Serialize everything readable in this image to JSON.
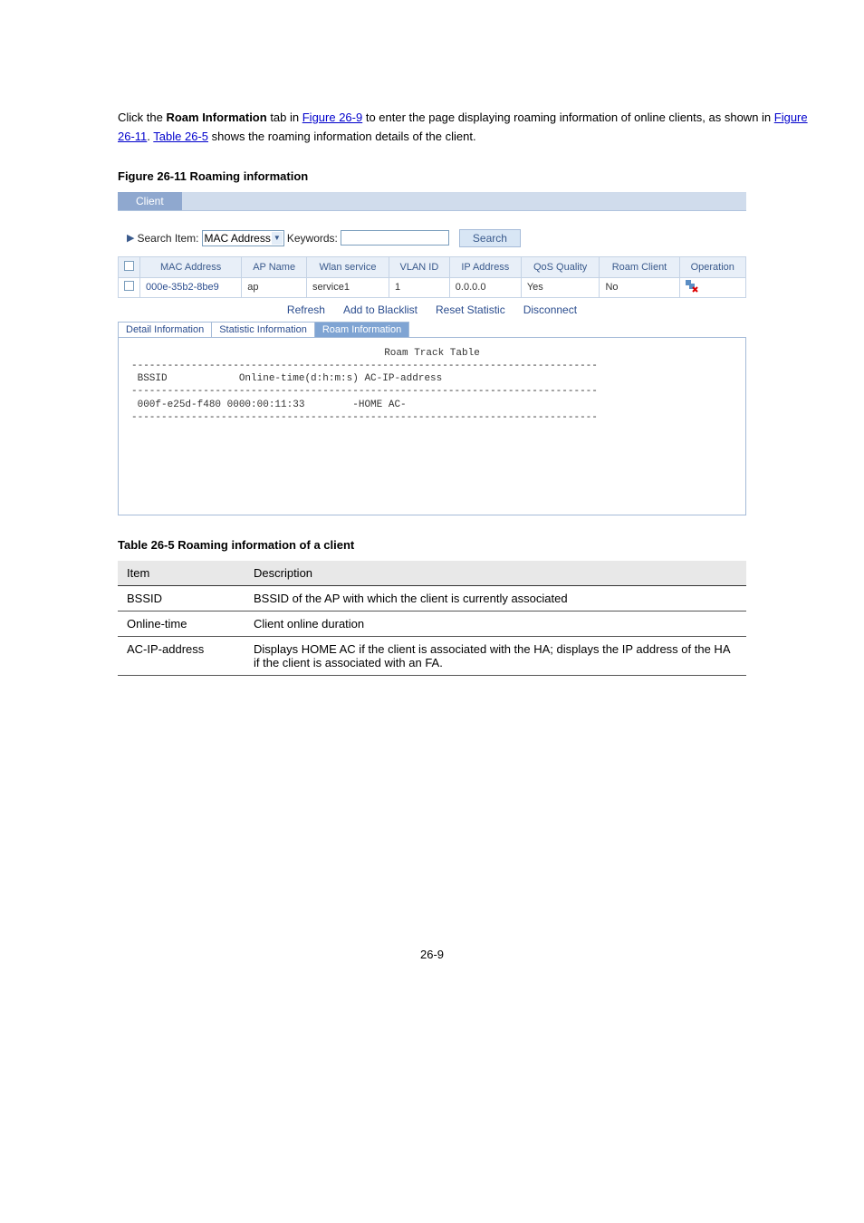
{
  "instruction": {
    "prefix": "Click the ",
    "tab_name": "Roam Information",
    "middle": " tab in ",
    "figure_ref": "Figure 26-9",
    "suffix": " to enter the page displaying roaming information of online clients, as shown in ",
    "figure_ref2": "Figure 26-11",
    "period": ". ",
    "table_ref": "Table 26-5",
    "table_suffix": " shows the roaming information details of the client."
  },
  "figure_caption": "Figure 26-11 Roaming information",
  "screenshot": {
    "tab": "Client",
    "search": {
      "label_item": "Search Item:",
      "select_value": "MAC Address",
      "label_keywords": "Keywords:",
      "input_value": "",
      "button": "Search"
    },
    "table_headers": [
      "MAC Address",
      "AP Name",
      "Wlan service",
      "VLAN ID",
      "IP Address",
      "QoS Quality",
      "Roam Client",
      "Operation"
    ],
    "table_row": {
      "mac": "000e-35b2-8be9",
      "ap": "ap",
      "wlan": "service1",
      "vlan": "1",
      "ip": "0.0.0.0",
      "qos": "Yes",
      "roam": "No",
      "op_icon": "disconnect-icon"
    },
    "actions": [
      "Refresh",
      "Add to Blacklist",
      "Reset Statistic",
      "Disconnect"
    ],
    "inner_tabs": [
      "Detail Information",
      "Statistic Information",
      "Roam Information"
    ],
    "roam_panel": {
      "title": "Roam Track Table",
      "sep": "------------------------------------------------------------------------------",
      "header": "BSSID            Online-time(d:h:m:s) AC-IP-address",
      "row": "000f-e25d-f480 0000:00:11:33        -HOME AC-"
    }
  },
  "table_caption": "Table 26-5 Roaming information of a client",
  "desc_table": {
    "headers": [
      "Item",
      "Description"
    ],
    "rows": [
      {
        "item": "BSSID",
        "desc": "BSSID of the AP with which the client is currently associated"
      },
      {
        "item": "Online-time",
        "desc": "Client online duration"
      },
      {
        "item": "AC-IP-address",
        "desc": "Displays HOME AC if the client is associated with the HA; displays the IP address of the HA if the client is associated with an FA."
      }
    ]
  },
  "page_number": "26-9"
}
